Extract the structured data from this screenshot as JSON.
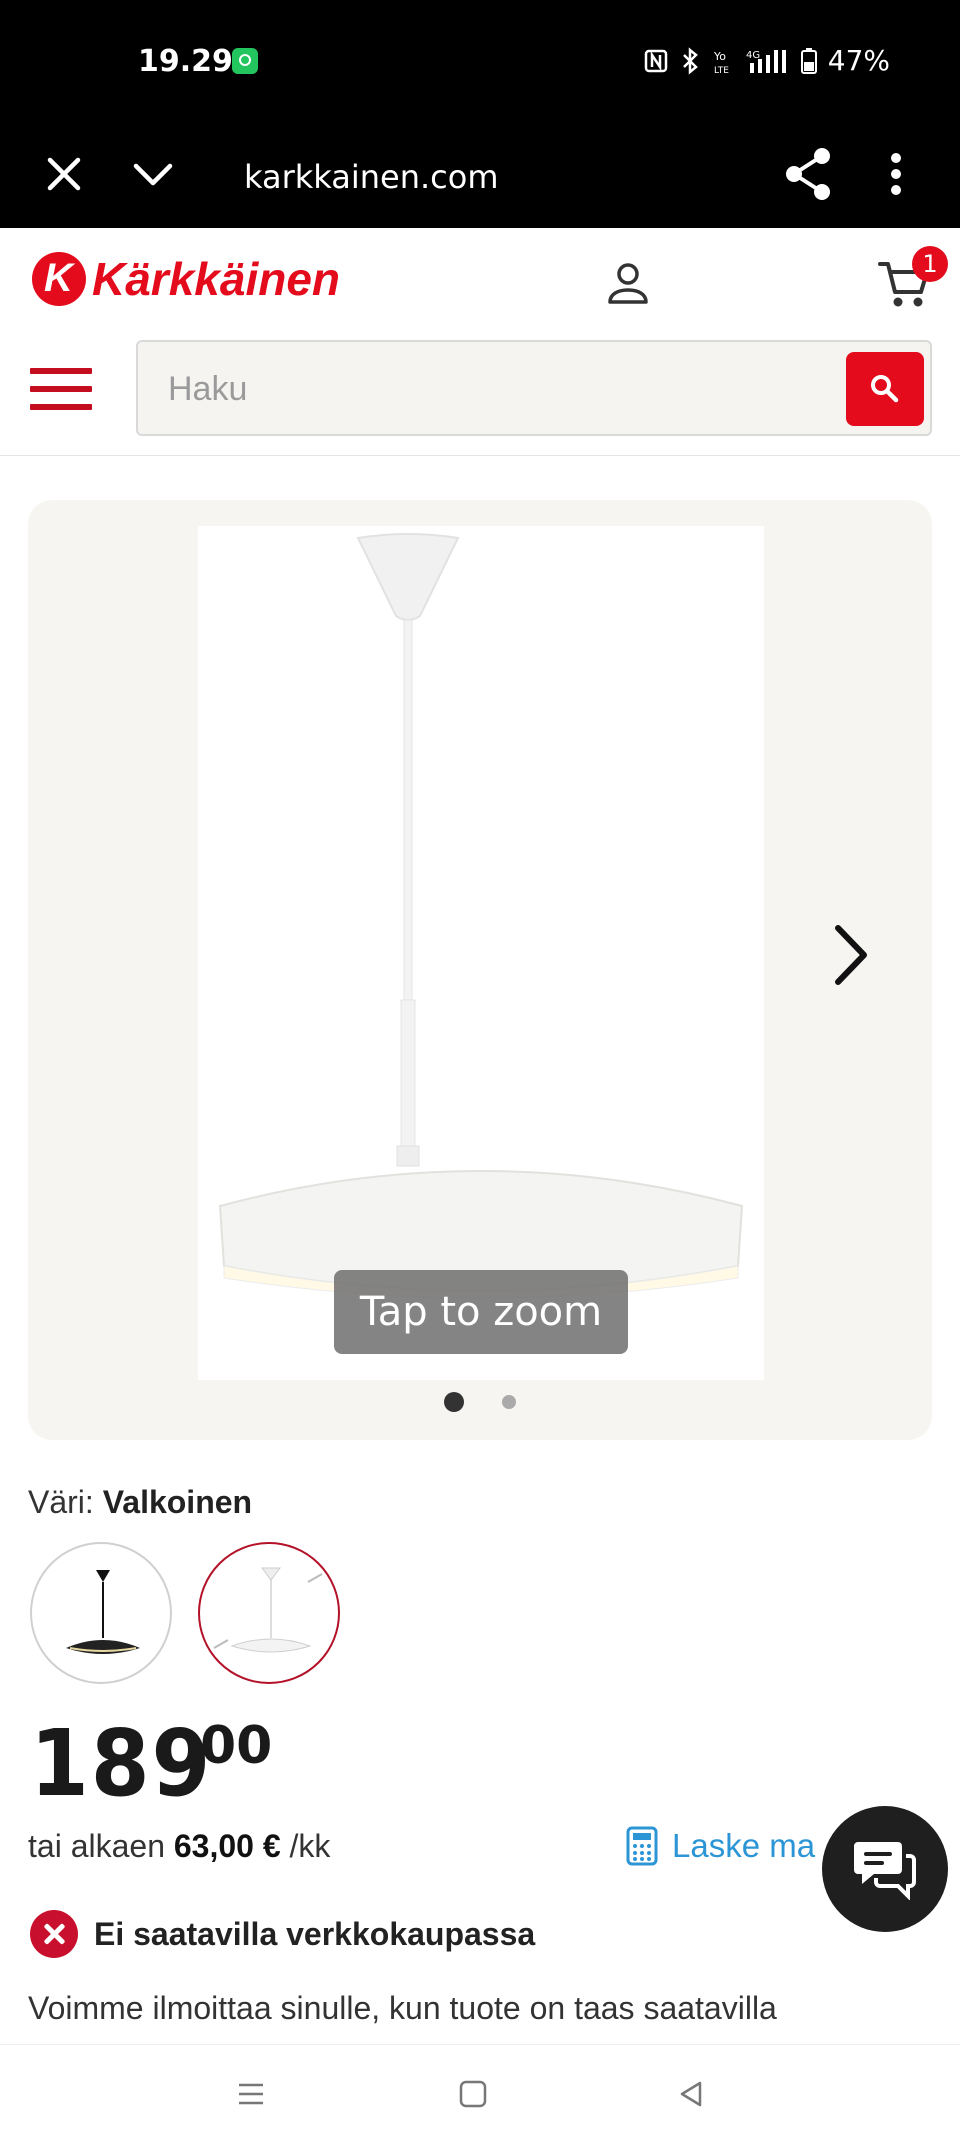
{
  "status_bar": {
    "time": "19.29",
    "battery": "47%",
    "icons": [
      "nfc-icon",
      "bluetooth-icon",
      "volte-icon",
      "4g-signal-icon",
      "battery-icon"
    ]
  },
  "browser": {
    "url": "karkkainen.com"
  },
  "site": {
    "logo_text": "Kärkkäinen",
    "cart_count": "1",
    "search_placeholder": "Haku",
    "brand_color": "#e30b1c"
  },
  "gallery": {
    "zoom_hint": "Tap to zoom",
    "current_slide": 1,
    "total_slides": 2
  },
  "product": {
    "color_label": "Väri:",
    "color_value": "Valkoinen",
    "swatches": [
      "black",
      "white"
    ],
    "selected_swatch": "white",
    "price_int": "189",
    "price_dec": "00",
    "finance_prefix": "tai alkaen",
    "finance_amount": "63,00 €",
    "finance_suffix": "/kk",
    "calc_link": "Laske ma",
    "stock_status": "Ei saatavilla verkkokaupassa",
    "notify_text": "Voimme ilmoittaa sinulle, kun tuote on taas saatavilla"
  }
}
